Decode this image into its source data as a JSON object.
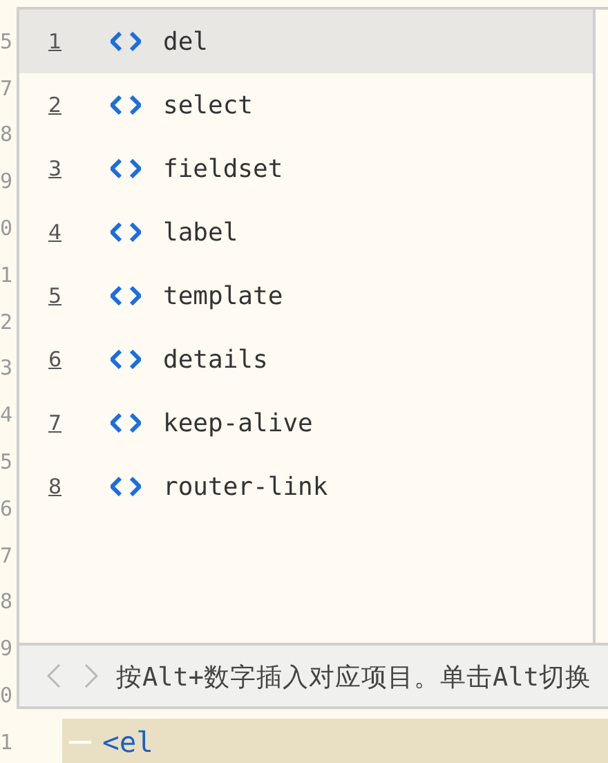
{
  "editor": {
    "line_numbers": [
      "5",
      "7",
      "8",
      "9",
      "0",
      "1",
      "2",
      "3",
      "4",
      "5",
      "6",
      "7",
      "8",
      "9",
      "0"
    ],
    "current_line": {
      "number": "1",
      "code": "<el"
    }
  },
  "completion_popup": {
    "items": [
      {
        "index": "1",
        "label": "del",
        "selected": true
      },
      {
        "index": "2",
        "label": "select",
        "selected": false
      },
      {
        "index": "3",
        "label": "fieldset",
        "selected": false
      },
      {
        "index": "4",
        "label": "label",
        "selected": false
      },
      {
        "index": "5",
        "label": "template",
        "selected": false
      },
      {
        "index": "6",
        "label": "details",
        "selected": false
      },
      {
        "index": "7",
        "label": "keep-alive",
        "selected": false
      },
      {
        "index": "8",
        "label": "router-link",
        "selected": false
      }
    ],
    "hint": "按Alt+数字插入对应项目。单击Alt切换"
  }
}
